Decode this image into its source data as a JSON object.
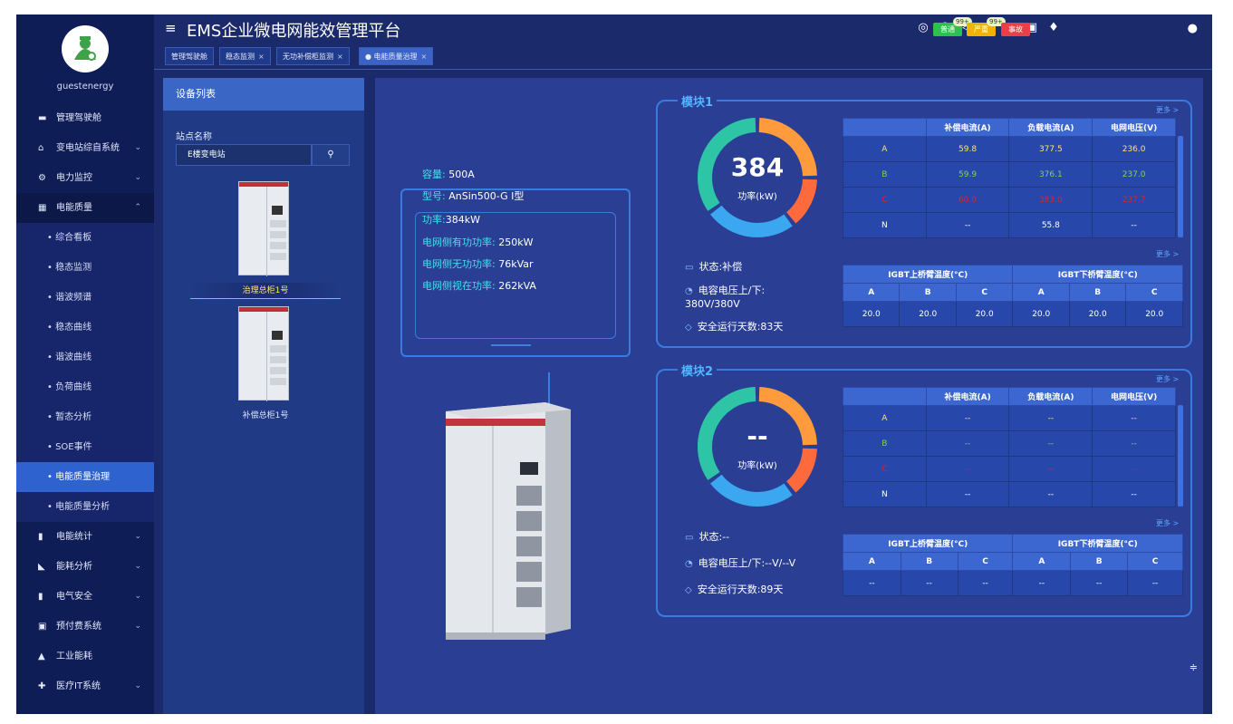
{
  "app": {
    "title": "EMS企业微电网能效管理平台",
    "username": "guestenergy"
  },
  "header": {
    "icons": [
      "settings-icon",
      "search-icon",
      "mute-icon",
      "refresh-icon",
      "fullscreen-icon",
      "image-icon",
      "shirt-icon"
    ],
    "alerts": [
      {
        "label": "普通",
        "count": "99+",
        "color": "#2fbf4f"
      },
      {
        "label": "严重",
        "count": "99+",
        "color": "#f0b400"
      },
      {
        "label": "事故",
        "count": "",
        "color": "#e8404a"
      }
    ]
  },
  "tabs": [
    {
      "label": "管理驾驶舱",
      "closable": false
    },
    {
      "label": "稳态监测",
      "closable": true
    },
    {
      "label": "无功补偿柜监测",
      "closable": true
    },
    {
      "label": "电能质量治理",
      "closable": true,
      "active": true
    }
  ],
  "sidebar": {
    "items": [
      {
        "label": "管理驾驶舱",
        "icon": "monitor-icon"
      },
      {
        "label": "变电站综自系统",
        "icon": "home-icon",
        "chevron": "⌄"
      },
      {
        "label": "电力监控",
        "icon": "power-icon",
        "chevron": "⌄"
      },
      {
        "label": "电能质量",
        "icon": "chart-icon",
        "chevron": "⌃",
        "open": true,
        "children": [
          "综合看板",
          "稳态监测",
          "谐波频谱",
          "稳态曲线",
          "谐波曲线",
          "负荷曲线",
          "暂态分析",
          "SOE事件",
          "电能质量治理",
          "电能质量分析"
        ],
        "active_child": 8
      },
      {
        "label": "电能统计",
        "icon": "bar-chart-icon",
        "chevron": "⌄"
      },
      {
        "label": "能耗分析",
        "icon": "area-chart-icon",
        "chevron": "⌄"
      },
      {
        "label": "电气安全",
        "icon": "battery-icon",
        "chevron": "⌄"
      },
      {
        "label": "预付费系统",
        "icon": "card-icon",
        "chevron": "⌄"
      },
      {
        "label": "工业能耗",
        "icon": "factory-icon"
      },
      {
        "label": "医疗IT系统",
        "icon": "hospital-icon",
        "chevron": "⌄"
      }
    ]
  },
  "device_panel": {
    "title": "设备列表",
    "station_label": "站点名称",
    "station_value": "E楼变电站",
    "cabinets": [
      "治理总柜1号",
      "补偿总柜1号"
    ],
    "selected": 0
  },
  "device_info": {
    "capacity_label": "容量:",
    "capacity": "500A",
    "model_label": "型号:",
    "model": "AnSin500-G I型",
    "power_label": "功率:",
    "power": "384kW",
    "active_label": "电网侧有功功率:",
    "active": "250kW",
    "reactive_label": "电网侧无功功率:",
    "reactive": "76kVar",
    "apparent_label": "电网侧视在功率:",
    "apparent": "262kVA"
  },
  "modules": [
    {
      "title": "模块1",
      "power_value": "384",
      "power_label": "功率(kW)",
      "status": "状态:补偿",
      "cap_voltage": "电容电压上/下:",
      "cap_voltage_value": "380V/380V",
      "safe_days": "安全运行天数:83天",
      "more": "更多 >",
      "table1": {
        "headers": [
          "",
          "补偿电流(A)",
          "负载电流(A)",
          "电网电压(V)"
        ],
        "rows": [
          [
            "A",
            "59.8",
            "377.5",
            "236.0"
          ],
          [
            "B",
            "59.9",
            "376.1",
            "237.0"
          ],
          [
            "C",
            "60.0",
            "383.0",
            "237.7"
          ],
          [
            "N",
            "--",
            "55.8",
            "--"
          ]
        ]
      },
      "table2": {
        "group1": "IGBT上桥臂温度(°C)",
        "group2": "IGBT下桥臂温度(°C)",
        "cols": [
          "A",
          "B",
          "C",
          "A",
          "B",
          "C"
        ],
        "values": [
          "20.0",
          "20.0",
          "20.0",
          "20.0",
          "20.0",
          "20.0"
        ]
      }
    },
    {
      "title": "模块2",
      "power_value": "--",
      "power_label": "功率(kW)",
      "status": "状态:--",
      "cap_voltage": "电容电压上/下:--V/--V",
      "cap_voltage_value": "",
      "safe_days": "安全运行天数:89天",
      "more": "更多 >",
      "table1": {
        "headers": [
          "",
          "补偿电流(A)",
          "负载电流(A)",
          "电网电压(V)"
        ],
        "rows": [
          [
            "A",
            "--",
            "--",
            "--"
          ],
          [
            "B",
            "--",
            "--",
            "--"
          ],
          [
            "C",
            "--",
            "--",
            "--"
          ],
          [
            "N",
            "--",
            "--",
            "--"
          ]
        ]
      },
      "table2": {
        "group1": "IGBT上桥臂温度(°C)",
        "group2": "IGBT下桥臂温度(°C)",
        "cols": [
          "A",
          "B",
          "C",
          "A",
          "B",
          "C"
        ],
        "values": [
          "--",
          "--",
          "--",
          "--",
          "--",
          "--"
        ]
      }
    }
  ],
  "colors": {
    "phase_a": "#ffe36a",
    "phase_b": "#7fd35a",
    "phase_c": "#e0202a",
    "donut": [
      "#ff9a3d",
      "#ff6a3d",
      "#3aa7f0",
      "#2ec4a6"
    ]
  }
}
